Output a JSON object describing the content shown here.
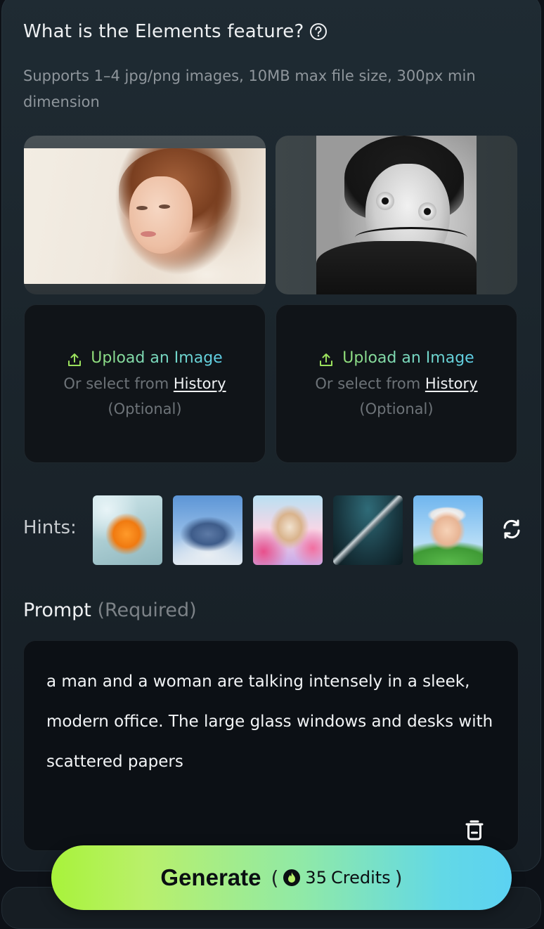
{
  "elements": {
    "title": "What is the Elements feature?",
    "subtitle": "Supports 1–4 jpg/png images, 10MB max file size, 300px min dimension"
  },
  "upload_slots": [
    {
      "upload_label": "Upload an Image",
      "or_select": "Or select from",
      "history_link": "History",
      "optional": "(Optional)"
    },
    {
      "upload_label": "Upload an Image",
      "or_select": "Or select from",
      "history_link": "History",
      "optional": "(Optional)"
    }
  ],
  "hints": {
    "label": "Hints:",
    "thumbnails": [
      "goldfish",
      "pegasus",
      "kitten-candy",
      "sword-ruins",
      "cartoon-boy"
    ]
  },
  "prompt": {
    "label": "Prompt",
    "required": "(Required)",
    "value": "a man and a woman are talking intensely in a sleek, modern office. The large glass windows and desks with scattered papers"
  },
  "generate": {
    "label": "Generate",
    "open_paren": "(",
    "credits_value": "35",
    "credits_unit": "Credits",
    "close_paren": ")"
  },
  "colors": {
    "accent_green": "#9be15d",
    "accent_cyan": "#5ecfe8",
    "background": "#0d1117"
  },
  "icons": [
    "help-circle-icon",
    "upload-icon",
    "refresh-icon",
    "trash-icon",
    "flame-icon"
  ]
}
